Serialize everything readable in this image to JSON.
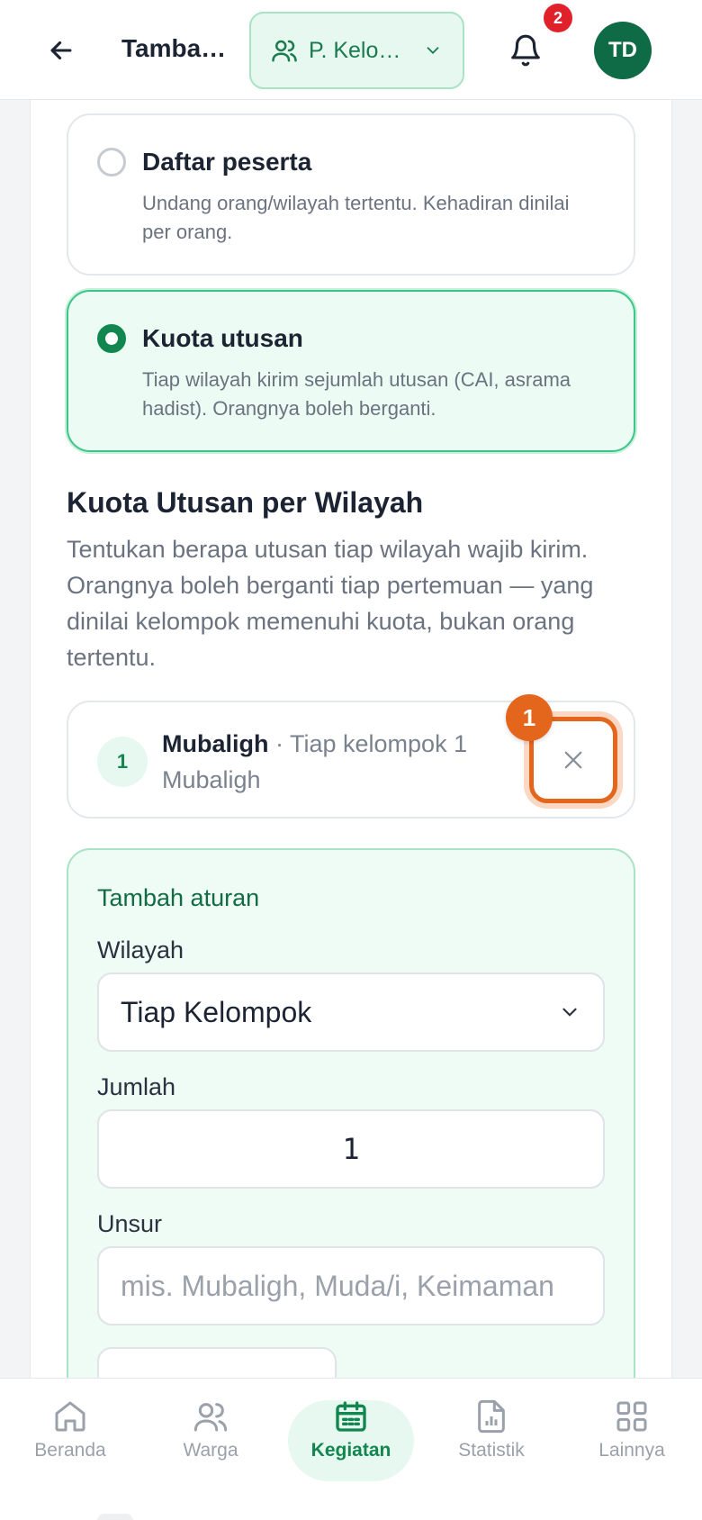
{
  "header": {
    "title": "Tamba…",
    "group_select": "P. Kelo…",
    "notification_count": "2",
    "avatar_initials": "TD"
  },
  "mode_options": [
    {
      "title": "Daftar peserta",
      "desc": "Undang orang/wilayah tertentu. Kehadiran dinilai per orang.",
      "selected": false
    },
    {
      "title": "Kuota utusan",
      "desc": "Tiap wilayah kirim sejumlah utusan (CAI, asrama hadist). Orangnya boleh berganti.",
      "selected": true
    }
  ],
  "quota_section": {
    "title": "Kuota Utusan per Wilayah",
    "desc": "Tentukan berapa utusan tiap wilayah wajib kirim. Orangnya boleh berganti tiap pertemuan — yang dinilai kelompok memenuhi kuota, bukan orang tertentu."
  },
  "rules": [
    {
      "number": "1",
      "name": "Mubaligh",
      "detail": " · Tiap kelompok 1 Mubaligh"
    }
  ],
  "step_badge": "1",
  "add_rule": {
    "title": "Tambah aturan",
    "wilayah_label": "Wilayah",
    "wilayah_value": "Tiap Kelompok",
    "jumlah_label": "Jumlah",
    "jumlah_value": "1",
    "unsur_label": "Unsur",
    "unsur_placeholder": "mis. Mubaligh, Muda/i, Keimaman"
  },
  "bottom_nav": [
    {
      "label": "Beranda",
      "icon": "home-icon",
      "active": false
    },
    {
      "label": "Warga",
      "icon": "users-icon",
      "active": false
    },
    {
      "label": "Kegiatan",
      "icon": "calendar-icon",
      "active": true
    },
    {
      "label": "Statistik",
      "icon": "chart-file-icon",
      "active": false
    },
    {
      "label": "Lainnya",
      "icon": "grid-icon",
      "active": false
    }
  ],
  "colors": {
    "primary": "#12864f",
    "primary_soft": "#e6f8ef",
    "accent_orange": "#e4661c",
    "badge_red": "#e0202a"
  }
}
